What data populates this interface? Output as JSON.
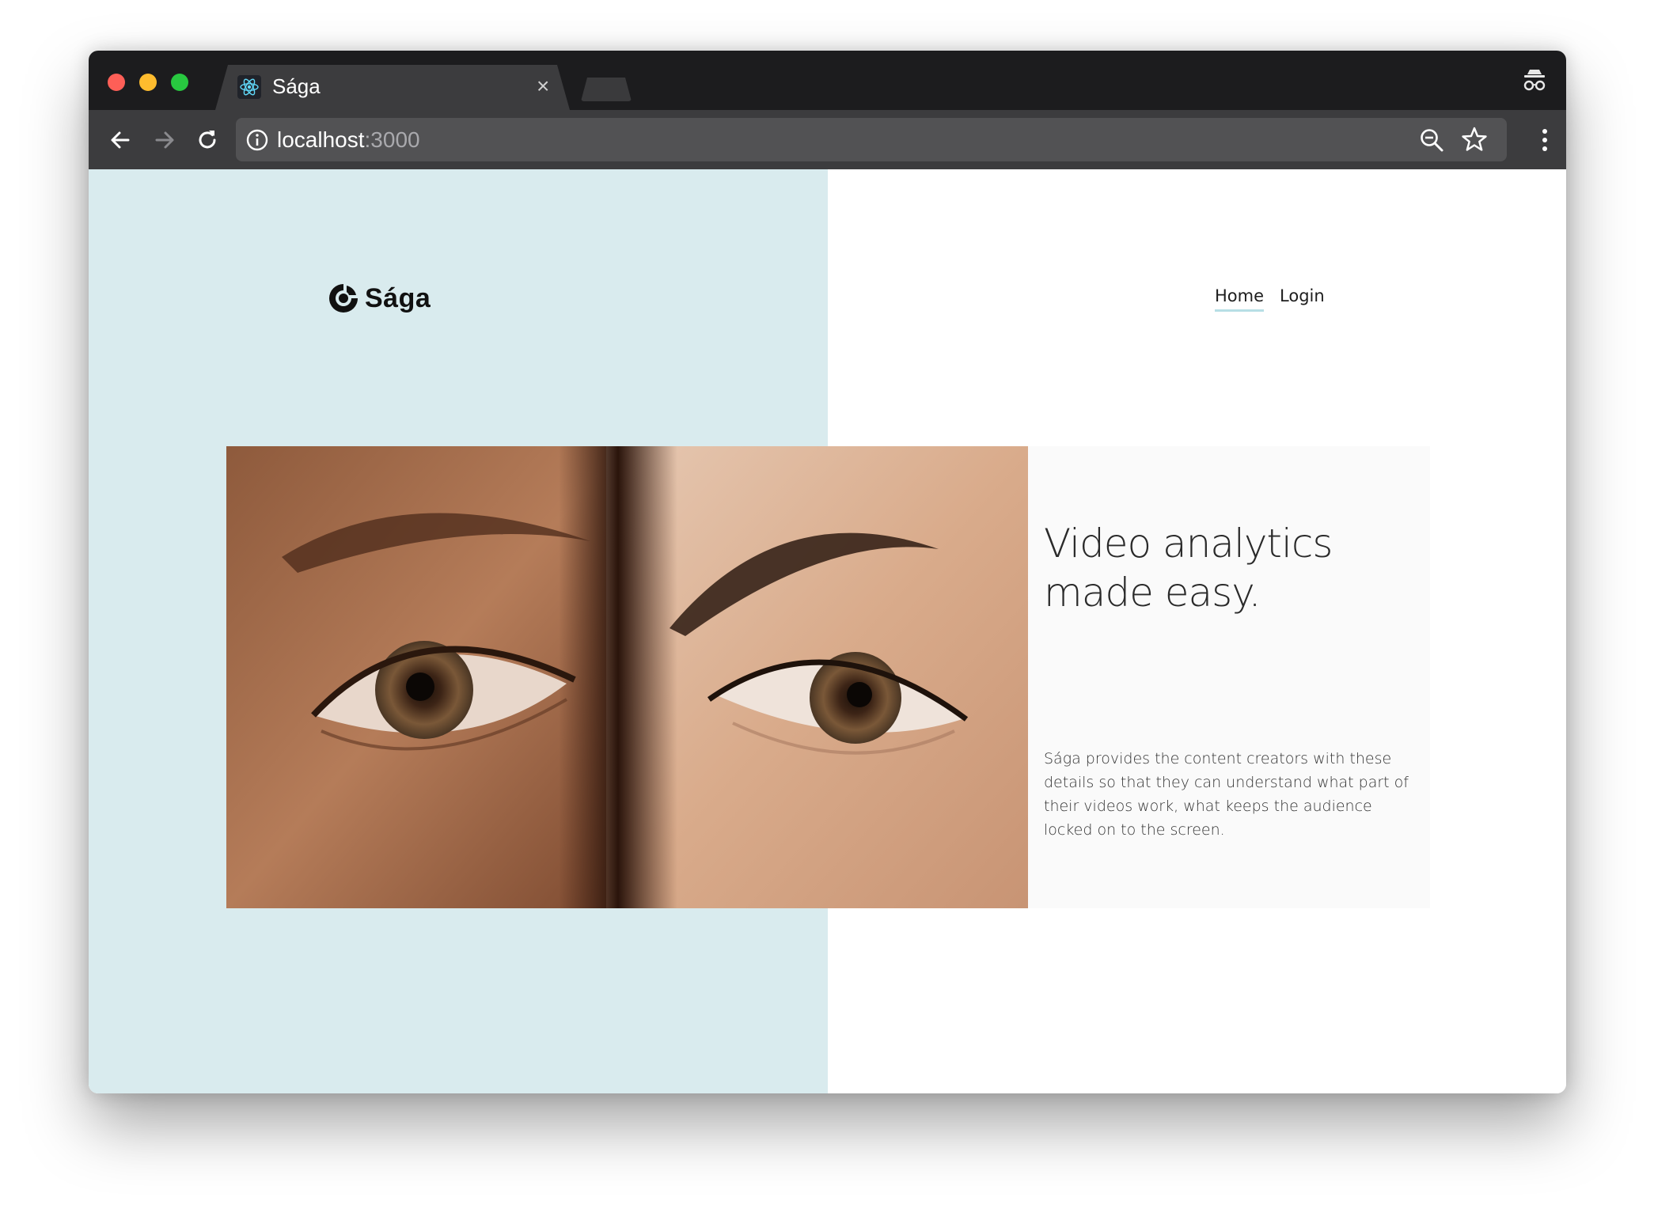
{
  "browser": {
    "tab_title": "Sága",
    "tab_close": "×",
    "url_host": "localhost",
    "url_port": ":3000"
  },
  "icons": {
    "favicon": "react-atom-icon",
    "incognito": "incognito-icon",
    "back": "arrow-left-icon",
    "forward": "arrow-right-icon",
    "reload": "reload-icon",
    "site_info": "info-icon",
    "zoom": "zoom-out-icon",
    "bookmark": "star-icon",
    "menu": "kebab-menu-icon",
    "logo": "saga-logo-mark"
  },
  "site": {
    "logo_text": "Sága",
    "nav": [
      {
        "label": "Home",
        "active": true
      },
      {
        "label": "Login",
        "active": false
      }
    ],
    "hero": {
      "title_line1": "Video analytics",
      "title_line2": "made easy.",
      "description": "Sága provides the content creators with these details so that they can understand what part of their videos work, what keeps the audience locked on to the screen.",
      "image": "close-up of two faces with eyes side by side"
    }
  },
  "colors": {
    "left_panel": "#d9ebee",
    "nav_active_underline": "#b7dfe5",
    "hero_card": "#fafafa",
    "chrome_dark": "#1c1c1e",
    "chrome_toolbar": "#3c3c3e"
  }
}
